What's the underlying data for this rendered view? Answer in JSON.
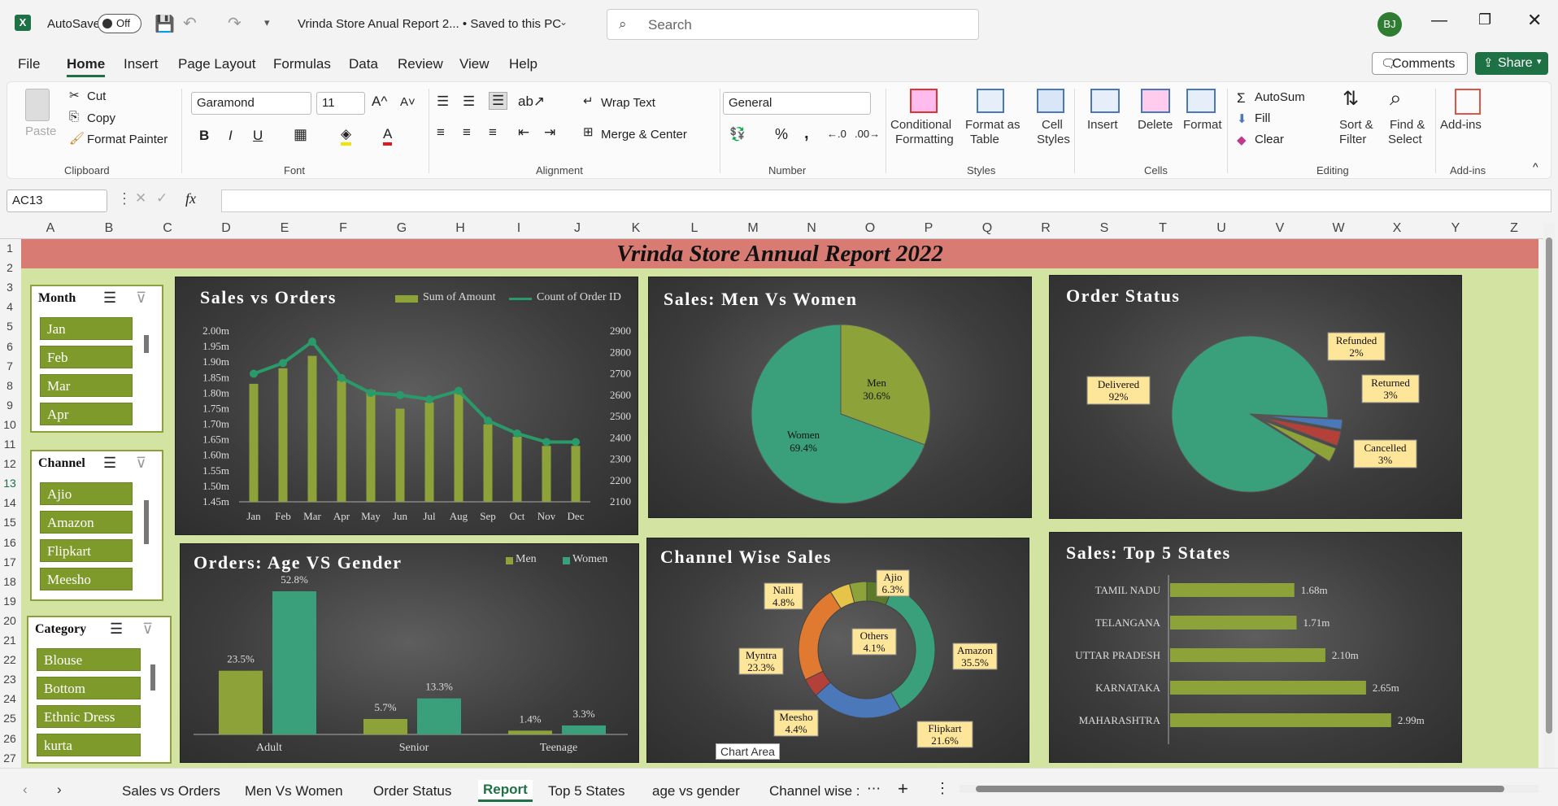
{
  "window": {
    "title": "Vrinda Store Anual Report 2... • Saved to this PC",
    "autosave_label": "AutoSave",
    "autosave_state": "Off",
    "search_placeholder": "Search",
    "user_initials": "BJ"
  },
  "menu": [
    "File",
    "Home",
    "Insert",
    "Page Layout",
    "Formulas",
    "Data",
    "Review",
    "View",
    "Help"
  ],
  "menu_right": {
    "comments": "Comments",
    "share": "Share"
  },
  "ribbon": {
    "clipboard": {
      "paste": "Paste",
      "cut": "Cut",
      "copy": "Copy",
      "format_painter": "Format Painter",
      "group": "Clipboard"
    },
    "font": {
      "name": "Garamond",
      "size": "11",
      "group": "Font",
      "bold": "B",
      "italic": "I",
      "underline": "U"
    },
    "alignment": {
      "wrap": "Wrap Text",
      "merge": "Merge & Center",
      "group": "Alignment"
    },
    "number": {
      "format": "General",
      "group": "Number",
      "percent": "%",
      "comma": ","
    },
    "styles": {
      "conditional": "Conditional",
      "conditional2": "Formatting",
      "format_table": "Format as",
      "format_table2": "Table",
      "cell_styles": "Cell",
      "cell_styles2": "Styles",
      "group": "Styles"
    },
    "cells": {
      "insert": "Insert",
      "delete": "Delete",
      "format": "Format",
      "group": "Cells"
    },
    "editing": {
      "autosum": "AutoSum",
      "fill": "Fill",
      "clear": "Clear",
      "sort": "Sort &",
      "sort2": "Filter",
      "find": "Find &",
      "find2": "Select",
      "group": "Editing"
    },
    "addins": {
      "addins": "Add-ins",
      "group": "Add-ins"
    }
  },
  "formula_bar": {
    "name_box": "AC13",
    "fx": "fx",
    "value": ""
  },
  "columns": [
    "A",
    "B",
    "C",
    "D",
    "E",
    "F",
    "G",
    "H",
    "I",
    "J",
    "K",
    "L",
    "M",
    "N",
    "O",
    "P",
    "Q",
    "R",
    "S",
    "T",
    "U",
    "V",
    "W",
    "X",
    "Y",
    "Z"
  ],
  "rows": [
    "1",
    "2",
    "3",
    "4",
    "5",
    "6",
    "7",
    "8",
    "9",
    "10",
    "11",
    "12",
    "13",
    "14",
    "15",
    "16",
    "17",
    "18",
    "19",
    "20",
    "21",
    "22",
    "23",
    "24",
    "25",
    "26",
    "27"
  ],
  "banner": "Vrinda Store Annual Report 2022",
  "slicers": [
    {
      "title": "Month",
      "items": [
        "Jan",
        "Feb",
        "Mar",
        "Apr"
      ]
    },
    {
      "title": "Channel",
      "items": [
        "Ajio",
        "Amazon",
        "Flipkart",
        "Meesho"
      ]
    },
    {
      "title": "Category",
      "items": [
        "Blouse",
        "Bottom",
        "Ethnic Dress",
        "kurta"
      ]
    }
  ],
  "colors": {
    "green": "#8ea23a",
    "teal": "#3aa07c",
    "red": "#b4403a",
    "blue": "#4a78b8",
    "orange": "#e07a30",
    "yellow": "#e6c44a",
    "darkgreen": "#5c7a2a"
  },
  "chart_data": [
    {
      "type": "bar",
      "title": "Sales vs Orders",
      "categories": [
        "Jan",
        "Feb",
        "Mar",
        "Apr",
        "May",
        "Jun",
        "Jul",
        "Aug",
        "Sep",
        "Oct",
        "Nov",
        "Dec"
      ],
      "series": [
        {
          "name": "Sum of Amount",
          "type": "bar",
          "axis": "left",
          "values": [
            1.83,
            1.88,
            1.92,
            1.84,
            1.81,
            1.75,
            1.77,
            1.8,
            1.7,
            1.66,
            1.63,
            1.63
          ]
        },
        {
          "name": "Count of Order ID",
          "type": "line",
          "axis": "right",
          "values": [
            2700,
            2750,
            2850,
            2680,
            2610,
            2600,
            2580,
            2620,
            2480,
            2420,
            2380,
            2380
          ]
        }
      ],
      "yticks_left": [
        "2.00m",
        "1.95m",
        "1.90m",
        "1.85m",
        "1.80m",
        "1.75m",
        "1.70m",
        "1.65m",
        "1.60m",
        "1.55m",
        "1.50m",
        "1.45m"
      ],
      "yticks_right": [
        "2900",
        "2800",
        "2700",
        "2600",
        "2500",
        "2400",
        "2300",
        "2200",
        "2100"
      ],
      "ylim_left": [
        1.45,
        2.0
      ],
      "ylim_right": [
        2100,
        2900
      ],
      "legend": "top"
    },
    {
      "type": "pie",
      "title": "Sales: Men Vs Women",
      "slices": [
        {
          "label": "Men",
          "value": 30.6,
          "text": "30.6%"
        },
        {
          "label": "Women",
          "value": 69.4,
          "text": "69.4%"
        }
      ]
    },
    {
      "type": "pie",
      "title": "Order Status",
      "slices": [
        {
          "label": "Delivered",
          "value": 92,
          "text": "92%"
        },
        {
          "label": "Refunded",
          "value": 2,
          "text": "2%"
        },
        {
          "label": "Returned",
          "value": 3,
          "text": "3%"
        },
        {
          "label": "Cancelled",
          "value": 3,
          "text": "3%"
        }
      ]
    },
    {
      "type": "bar",
      "title": "Orders: Age VS Gender",
      "categories": [
        "Adult",
        "Senior",
        "Teenage"
      ],
      "series": [
        {
          "name": "Men",
          "values": [
            23.5,
            5.7,
            1.4
          ],
          "labels": [
            "23.5%",
            "5.7%",
            "1.4%"
          ]
        },
        {
          "name": "Women",
          "values": [
            52.8,
            13.3,
            3.3
          ],
          "labels": [
            "52.8%",
            "13.3%",
            "3.3%"
          ]
        }
      ],
      "legend": "top-right"
    },
    {
      "type": "pie",
      "subtype": "doughnut",
      "title": "Channel Wise Sales",
      "slices": [
        {
          "label": "Ajio",
          "value": 6.3,
          "text": "6.3%"
        },
        {
          "label": "Amazon",
          "value": 35.5,
          "text": "35.5%"
        },
        {
          "label": "Flipkart",
          "value": 21.6,
          "text": "21.6%"
        },
        {
          "label": "Meesho",
          "value": 4.4,
          "text": "4.4%"
        },
        {
          "label": "Myntra",
          "value": 23.3,
          "text": "23.3%"
        },
        {
          "label": "Nalli",
          "value": 4.8,
          "text": "4.8%"
        },
        {
          "label": "Others",
          "value": 4.1,
          "text": "4.1%"
        }
      ],
      "tooltip": "Chart Area"
    },
    {
      "type": "bar",
      "orientation": "horizontal",
      "title": "Sales: Top 5 States",
      "categories": [
        "TAMIL NADU",
        "TELANGANA",
        "UTTAR PRADESH",
        "KARNATAKA",
        "MAHARASHTRA"
      ],
      "values": [
        1.68,
        1.71,
        2.1,
        2.65,
        2.99
      ],
      "labels": [
        "1.68m",
        "1.71m",
        "2.10m",
        "2.65m",
        "2.99m"
      ]
    }
  ],
  "sheet_tabs": [
    "Sales vs Orders",
    "Men Vs Women",
    "Order Status",
    "Report",
    "Top 5 States",
    "age vs gender",
    "Channel wise :"
  ],
  "active_tab": "Report"
}
